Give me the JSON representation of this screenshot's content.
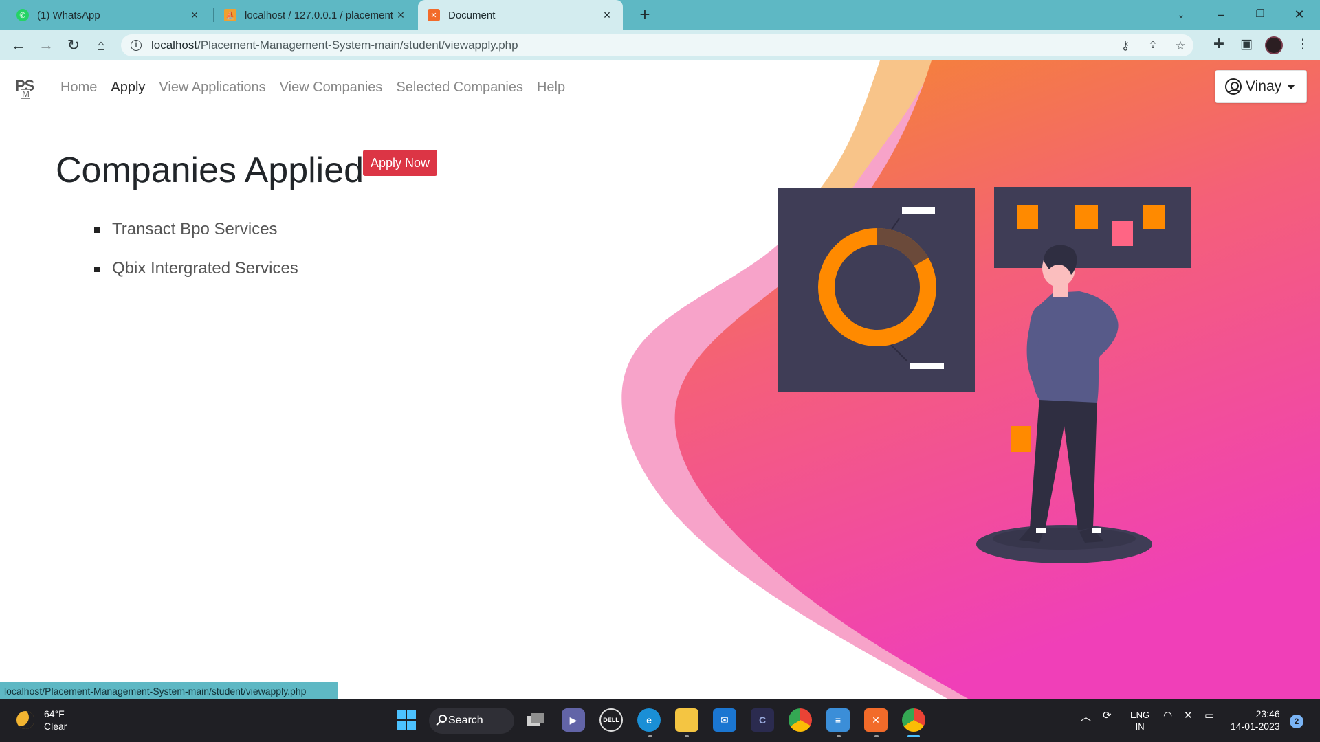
{
  "browser": {
    "tabs": [
      {
        "title": "(1) WhatsApp",
        "icon": "whatsapp-icon",
        "color": "#25d366",
        "active": false
      },
      {
        "title": "localhost / 127.0.0.1 / placement",
        "icon": "phpmyadmin-icon",
        "color": "#f0a030",
        "active": false
      },
      {
        "title": "Document",
        "icon": "xampp-icon",
        "color": "#f26b2a",
        "active": true
      }
    ],
    "url_host": "localhost",
    "url_path": "/Placement-Management-System-main/student/viewapply.php",
    "status_url": "localhost/Placement-Management-System-main/student/viewapply.php"
  },
  "site": {
    "brand": "PS",
    "brand_sub": "M",
    "nav": [
      "Home",
      "Apply",
      "View Applications",
      "View Companies",
      "Selected Companies",
      "Help"
    ],
    "active_nav": "Apply",
    "user": "Vinay",
    "heading": "Companies Applied",
    "apply_button": "Apply Now",
    "companies": [
      "Transact Bpo Services",
      "Qbix Intergrated Services"
    ]
  },
  "colors": {
    "tabstrip": "#5eb8c4",
    "toolbar": "#d3ecef",
    "apply_button": "#dc3545",
    "blob_start": "#f58a2a",
    "blob_end": "#f03fb8"
  },
  "taskbar": {
    "weather_temp": "64°F",
    "weather_desc": "Clear",
    "search_label": "Search",
    "lang_top": "ENG",
    "lang_bottom": "IN",
    "time": "23:46",
    "date": "14-01-2023",
    "notifications": "2"
  }
}
